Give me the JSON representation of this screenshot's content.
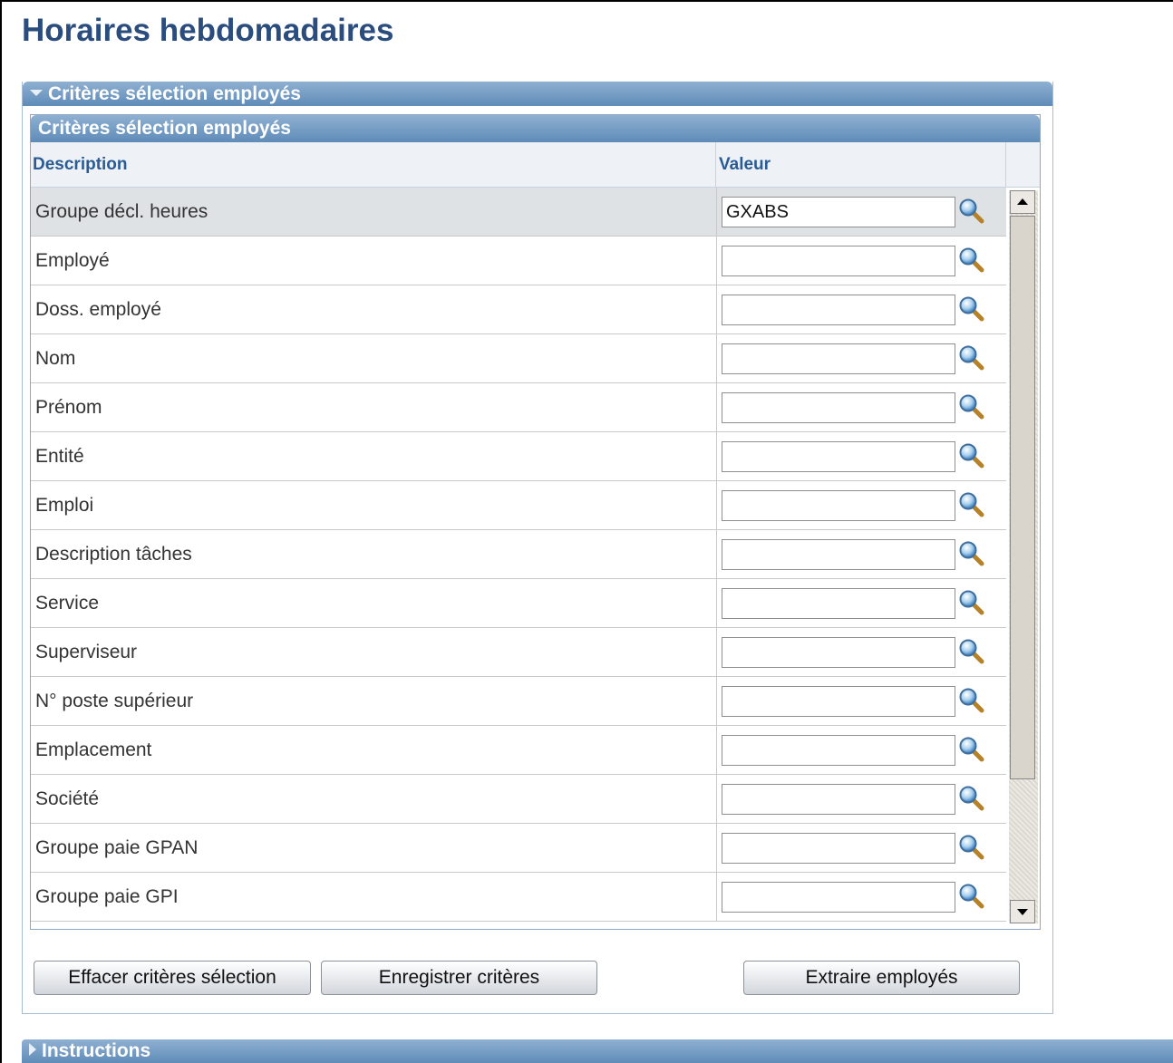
{
  "page": {
    "title": "Horaires hebdomadaires"
  },
  "section": {
    "title": "Critères sélection employés"
  },
  "grid": {
    "title": "Critères sélection employés",
    "columns": {
      "description": "Description",
      "value": "Valeur"
    },
    "rows": [
      {
        "label": "Groupe décl. heures",
        "value": "GXABS"
      },
      {
        "label": "Employé",
        "value": ""
      },
      {
        "label": "Doss. employé",
        "value": ""
      },
      {
        "label": "Nom",
        "value": ""
      },
      {
        "label": "Prénom",
        "value": ""
      },
      {
        "label": "Entité",
        "value": ""
      },
      {
        "label": "Emploi",
        "value": ""
      },
      {
        "label": "Description tâches",
        "value": ""
      },
      {
        "label": "Service",
        "value": ""
      },
      {
        "label": "Superviseur",
        "value": ""
      },
      {
        "label": "N° poste supérieur",
        "value": ""
      },
      {
        "label": "Emplacement",
        "value": ""
      },
      {
        "label": "Société",
        "value": ""
      },
      {
        "label": "Groupe paie GPAN",
        "value": ""
      },
      {
        "label": "Groupe paie GPI",
        "value": ""
      }
    ]
  },
  "buttons": {
    "clear": "Effacer critères sélection",
    "save": "Enregistrer critères",
    "extract": "Extraire employés"
  },
  "instructions": {
    "title": "Instructions"
  },
  "icons": {
    "lookup": "magnifier-icon",
    "collapse": "triangle-down-icon",
    "expand": "triangle-right-icon"
  },
  "colors": {
    "header_blue": "#5f8cb8",
    "title_blue": "#2a4d7e",
    "highlight_row": "#dfe2e4"
  }
}
